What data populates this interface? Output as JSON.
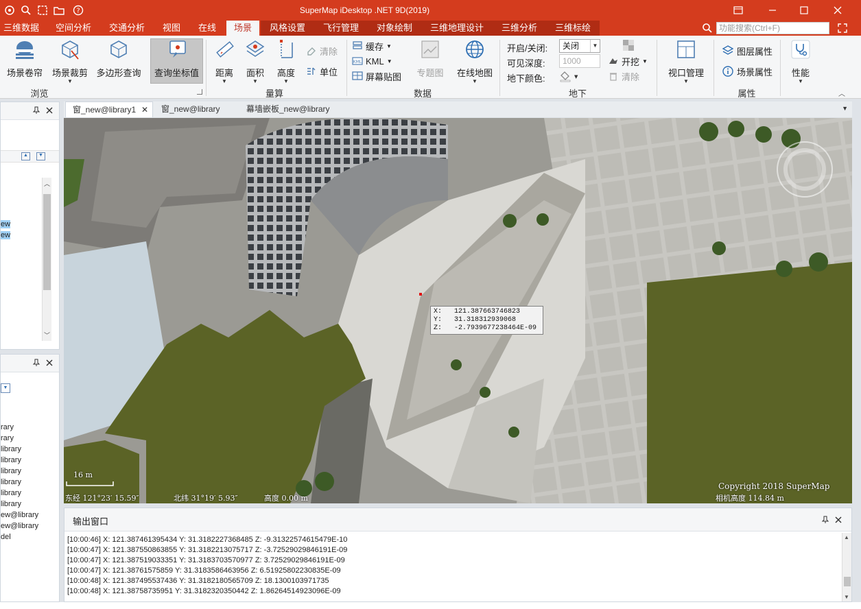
{
  "title_bar": {
    "title": "SuperMap iDesktop .NET 9D(2019)",
    "quick_access": [
      "app-menu-icon",
      "zoom-icon",
      "select-icon",
      "folder-icon",
      "help-icon"
    ]
  },
  "ribbon_tabs": [
    "三维数据",
    "空间分析",
    "交通分析",
    "视图",
    "在线",
    "场景",
    "风格设置",
    "飞行管理",
    "对象绘制",
    "三维地理设计",
    "三维分析",
    "三维标绘"
  ],
  "active_tab": "场景",
  "search": {
    "placeholder": "功能搜索(Ctrl+F)"
  },
  "ribbon": {
    "browse": {
      "label": "浏览",
      "scene_shutter": "场景卷帘",
      "scene_clip": "场景裁剪",
      "polygon_query": "多边形查询",
      "query_coord": "查询坐标值"
    },
    "measure": {
      "label": "量算",
      "distance": "距离",
      "area": "面积",
      "height": "高度",
      "clear": "清除",
      "unit": "单位"
    },
    "data": {
      "label": "数据",
      "cache": "缓存",
      "kml": "KML",
      "screen_texture": "屏幕贴图",
      "thematic_map": "专题图",
      "online_map": "在线地图"
    },
    "underground": {
      "label": "地下",
      "toggle_label": "开启/关闭:",
      "toggle_value": "关闭",
      "depth_label": "可见深度:",
      "depth_value": "1000",
      "color_label": "地下颜色:",
      "excavate": "开挖",
      "clear": "清除"
    },
    "viewport": {
      "label": "视口管理"
    },
    "properties": {
      "label": "属性",
      "layer_props": "图层属性",
      "scene_props": "场景属性"
    },
    "performance": {
      "label": "性能"
    }
  },
  "left_panel_top": {
    "items": [
      "ew",
      "ew"
    ]
  },
  "left_panel_bottom": {
    "items": [
      "rary",
      "rary",
      "library",
      "library",
      "library",
      "library",
      "library",
      "library",
      "ew@library",
      "ew@library",
      "del"
    ]
  },
  "doc_tabs": [
    "窗_new@library1",
    "窗_new@library",
    "幕墙嵌板_new@library"
  ],
  "scene": {
    "coord_popup": {
      "x_label": "X:",
      "x": "121.387663746823",
      "y_label": "Y:",
      "y": "31.318312939068",
      "z_label": "Z:",
      "z": "-2.7939677238464E-09"
    },
    "scale_label": "16 m",
    "status": {
      "lon": "东经 121°23′ 15.59″",
      "lat": "北纬 31°19′ 5.93″",
      "alt": "高度 0.00 m",
      "cam": "相机高度 114.84 m"
    },
    "copyright": "Copyright 2018 SuperMap",
    "colors": {
      "ground_olive": "#5b6326",
      "plaza": "#d6d5d0",
      "building": "#8f9090"
    }
  },
  "output": {
    "title": "输出窗口",
    "lines": [
      "[10:00:46] X:   121.387461395434 Y:   31.3182227368485 Z:   -9.31322574615479E-10",
      "[10:00:47] X:   121.387550863855 Y:   31.3182213075717 Z:   -3.72529029846191E-09",
      "[10:00:47] X:   121.387519033351 Y:   31.3183703570977 Z:   3.72529029846191E-09",
      "[10:00:47] X:   121.38761575859 Y:   31.3183586463956 Z:   6.51925802230835E-09",
      "[10:00:48] X:   121.387495537436 Y:   31.3182180565709 Z:   18.1300103971735",
      "[10:00:48] X:   121.38758735951 Y:   31.3182320350442 Z:   1.86264514923096E-09"
    ]
  }
}
